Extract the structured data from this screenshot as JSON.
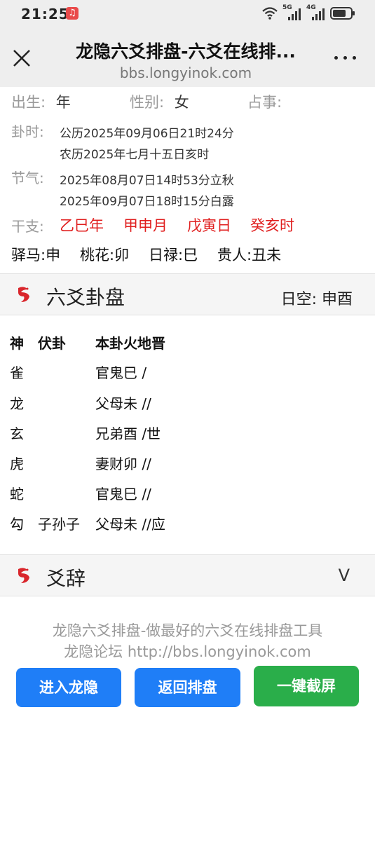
{
  "status_bar": {
    "time": "21:25",
    "network_5g": "5G",
    "network_4g": "4G"
  },
  "title_bar": {
    "title": "龙隐六爻排盘-六爻在线排...",
    "url": "bbs.longyinok.com"
  },
  "info": {
    "birth_label": "出生:",
    "birth_value": "年",
    "gender_label": "性别:",
    "gender_value": "女",
    "matter_label": "占事:",
    "guashi_label": "卦时:",
    "guashi_solar": "公历2025年09月06日21时24分",
    "guashi_lunar": "农历2025年七月十五日亥时",
    "jieqi_label": "节气:",
    "jieqi_1": "2025年08月07日14时53分立秋",
    "jieqi_2": "2025年09月07日18时15分白露",
    "ganzhi_label": "干支:",
    "ganzhi": [
      "乙巳年",
      "甲申月",
      "戊寅日",
      "癸亥时"
    ],
    "shensha": [
      "驿马:申",
      "桃花:卯",
      "日禄:巳",
      "贵人:丑未"
    ]
  },
  "gua_section": {
    "title": "六爻卦盘",
    "rikong": "日空: 申酉",
    "header": {
      "shen": "神",
      "fugua": "伏卦",
      "bengua": "本卦火地晋"
    },
    "rows": [
      {
        "shen": "雀",
        "fugua": "",
        "bengua": "官鬼巳 /"
      },
      {
        "shen": "龙",
        "fugua": "",
        "bengua": "父母未 //"
      },
      {
        "shen": "玄",
        "fugua": "",
        "bengua": "兄弟酉 /世"
      },
      {
        "shen": "虎",
        "fugua": "",
        "bengua": "妻财卯 //"
      },
      {
        "shen": "蛇",
        "fugua": "",
        "bengua": "官鬼巳 //"
      },
      {
        "shen": "勾",
        "fugua": "子孙子",
        "bengua": "父母未 //应"
      }
    ]
  },
  "yaoci_section": {
    "title": "爻辞",
    "toggle": "V"
  },
  "footer": {
    "line1": "龙隐六爻排盘-做最好的六爻在线排盘工具",
    "line2": "龙隐论坛 http://bbs.longyinok.com",
    "btn_enter": "进入龙隐",
    "btn_back": "返回排盘",
    "btn_screenshot": "一键截屏"
  },
  "colors": {
    "accent_red": "#e01e1e",
    "button_blue": "#1f7ef7",
    "button_green": "#2aae4a"
  }
}
